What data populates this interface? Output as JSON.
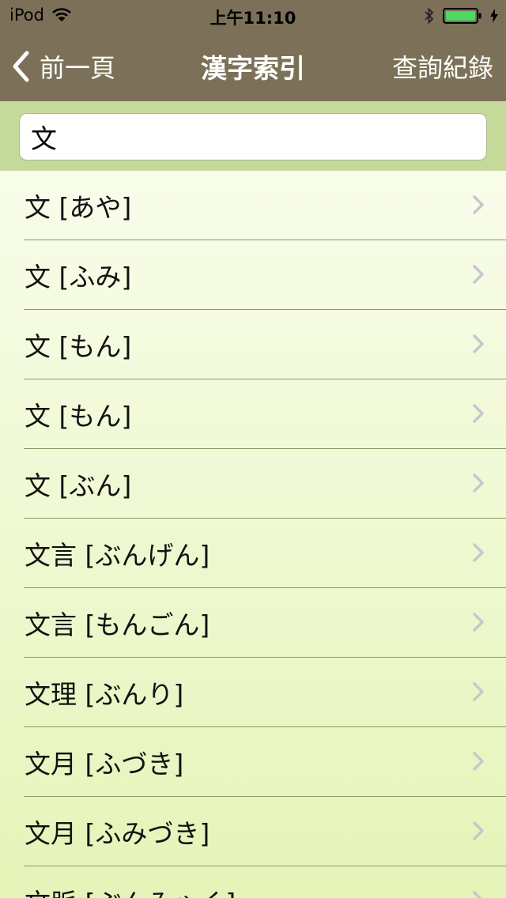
{
  "status_bar": {
    "carrier": "iPod",
    "time": "上午11:10"
  },
  "nav": {
    "back_label": "前一頁",
    "title": "漢字索引",
    "right_label": "查詢紀錄"
  },
  "search": {
    "value": "文"
  },
  "list": {
    "items": [
      "文 [あや]",
      "文 [ふみ]",
      "文 [もん]",
      "文 [もん]",
      "文 [ぶん]",
      "文言 [ぶんげん]",
      "文言 [もんごん]",
      "文理 [ぶんり]",
      "文月 [ふづき]",
      "文月 [ふみづき]",
      "文脈 [ぶんみゃく]"
    ]
  },
  "colors": {
    "bar_bg": "#7c7158",
    "search_bg": "#c5d99a",
    "battery_green": "#4cd964",
    "chevron": "#c7c7cc"
  },
  "icons": {
    "wifi": "wifi-icon",
    "bluetooth": "bluetooth-icon",
    "battery": "battery-icon",
    "charging": "charging-bolt-icon",
    "back": "chevron-left-icon",
    "disclosure": "chevron-right-icon"
  }
}
